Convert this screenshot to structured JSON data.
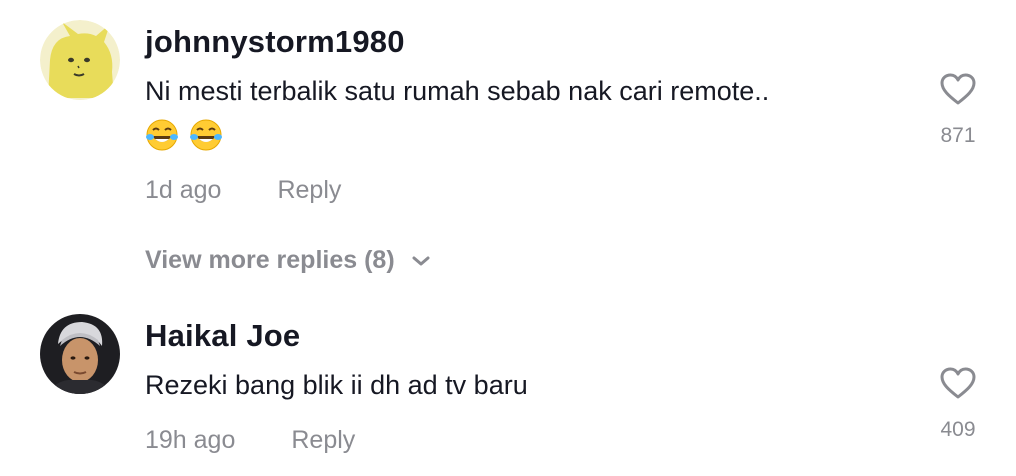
{
  "comments": [
    {
      "username": "johnnystorm1980",
      "text": "Ni mesti terbalik satu rumah sebab nak cari remote..",
      "emojis": [
        "face-with-tears-of-joy-icon",
        "face-with-tears-of-joy-icon"
      ],
      "time": "1d ago",
      "reply_label": "Reply",
      "likes": "871"
    },
    {
      "username": "Haikal Joe",
      "text": "Rezeki bang blik ii dh ad tv baru",
      "time": "19h ago",
      "reply_label": "Reply",
      "likes": "409"
    }
  ],
  "view_more": {
    "label": "View more replies (8)",
    "icon": "chevron-down-icon"
  },
  "colors": {
    "primary_text": "#161823",
    "secondary_text": "#8a8b91",
    "background": "#ffffff"
  }
}
